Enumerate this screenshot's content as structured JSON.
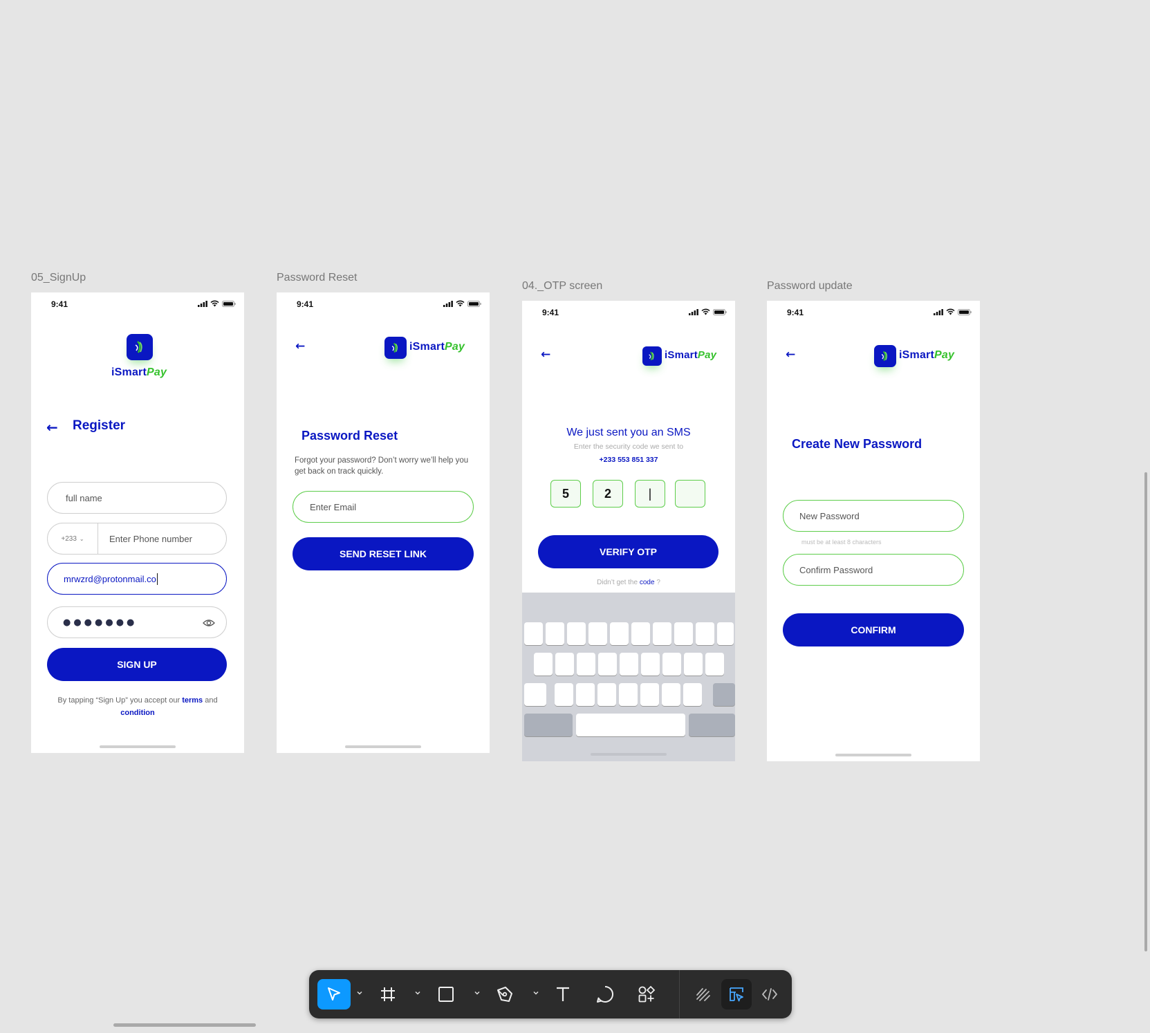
{
  "frames": {
    "signup": {
      "label": "05_SignUp"
    },
    "reset": {
      "label": "Password Reset"
    },
    "otp": {
      "label": "04._OTP screen"
    },
    "update": {
      "label": "Password update"
    }
  },
  "status": {
    "time": "9:41"
  },
  "brand": {
    "name_part1": "iSmart",
    "name_part2": "Pay",
    "blue": "#0a17c2",
    "green": "#35c12c"
  },
  "signup": {
    "title": "Register",
    "full_name_placeholder": "full name",
    "country_code": "+233",
    "phone_placeholder": "Enter Phone number",
    "email_value": "mrwzrd@protonmail.co",
    "password_mask": "●●●●●●●",
    "button": "SIGN UP",
    "terms_prefix": "By tapping “Sign Up” you accept our",
    "terms_link": "terms",
    "terms_and": "and",
    "condition_link": "condition"
  },
  "reset": {
    "title": "Password Reset",
    "subtitle": "Forgot your password? Don’t worry we’ll help you get back on track quickly.",
    "email_placeholder": "Enter Email",
    "button": "SEND RESET LINK"
  },
  "otp": {
    "title": "We just sent you an SMS",
    "subtitle": "Enter the security code we sent to",
    "phone": "+233 553 851 337",
    "digits": [
      "5",
      "2",
      "|",
      ""
    ],
    "button": "VERIFY OTP",
    "resend_prefix": "Didn’t get the",
    "resend_link": "code",
    "resend_suffix": "?"
  },
  "update": {
    "title": "Create New Password",
    "new_placeholder": "New Password",
    "hint": "must be at least 8 characters",
    "confirm_placeholder": "Confirm Password",
    "button": "CONFIRM"
  },
  "toolbar": {
    "tools": [
      "move-tool",
      "frame-tool",
      "shape-tool",
      "pen-tool",
      "text-tool",
      "comment-tool",
      "resources-tool",
      "draw-mode",
      "design-mode",
      "dev-mode"
    ]
  }
}
